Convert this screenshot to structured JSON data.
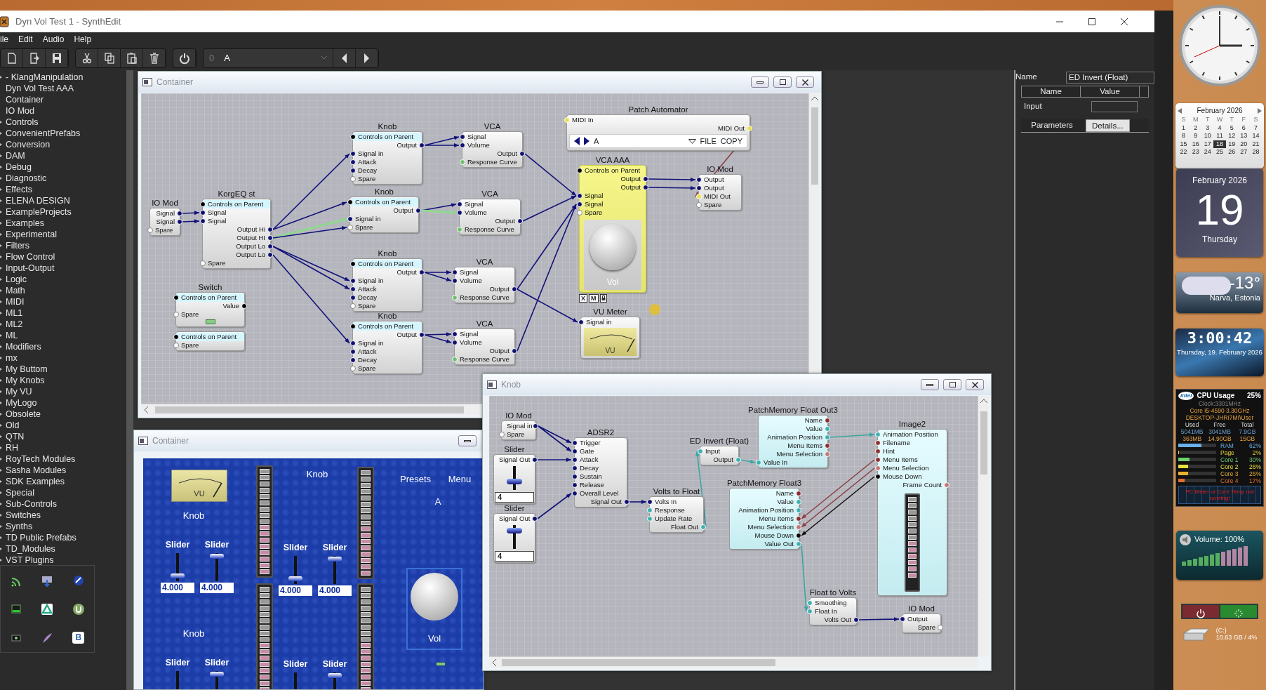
{
  "window": {
    "title": "Dyn Vol Test 1 - SynthEdit"
  },
  "menu": [
    "ile",
    "Edit",
    "Audio",
    "Help"
  ],
  "toolbar": {
    "counter": "0",
    "preset": "A"
  },
  "sidebar": {
    "items": [
      {
        "label": "- KlangManipulation",
        "expandable": true
      },
      {
        "label": "Dyn Vol Test AAA",
        "expandable": false
      },
      {
        "label": "Container",
        "expandable": false
      },
      {
        "label": "IO Mod",
        "expandable": false
      },
      {
        "label": "Controls",
        "expandable": true
      },
      {
        "label": "ConvenientPrefabs",
        "expandable": true
      },
      {
        "label": "Conversion",
        "expandable": true
      },
      {
        "label": "DAM",
        "expandable": true
      },
      {
        "label": "Debug",
        "expandable": true
      },
      {
        "label": "Diagnostic",
        "expandable": true
      },
      {
        "label": "Effects",
        "expandable": true
      },
      {
        "label": "ELENA DESIGN",
        "expandable": true
      },
      {
        "label": "ExampleProjects",
        "expandable": true
      },
      {
        "label": "Examples",
        "expandable": true
      },
      {
        "label": "Experimental",
        "expandable": true
      },
      {
        "label": "Filters",
        "expandable": true
      },
      {
        "label": "Flow Control",
        "expandable": true
      },
      {
        "label": "Input-Output",
        "expandable": true
      },
      {
        "label": "Logic",
        "expandable": true
      },
      {
        "label": "Math",
        "expandable": true
      },
      {
        "label": "MIDI",
        "expandable": true
      },
      {
        "label": "ML1",
        "expandable": true
      },
      {
        "label": "ML2",
        "expandable": true
      },
      {
        "label": "ML",
        "expandable": true
      },
      {
        "label": "Modifiers",
        "expandable": true
      },
      {
        "label": "mx",
        "expandable": true
      },
      {
        "label": "My Buttom",
        "expandable": true
      },
      {
        "label": "My Knobs",
        "expandable": true
      },
      {
        "label": "My VU",
        "expandable": true
      },
      {
        "label": "MyLogo",
        "expandable": true
      },
      {
        "label": "Obsolete",
        "expandable": true
      },
      {
        "label": "Old",
        "expandable": true
      },
      {
        "label": "QTN",
        "expandable": true
      },
      {
        "label": "RH",
        "expandable": true
      },
      {
        "label": "RoyTech Modules",
        "expandable": true
      },
      {
        "label": "Sasha Modules",
        "expandable": true
      },
      {
        "label": "SDK Examples",
        "expandable": true
      },
      {
        "label": "Special",
        "expandable": true
      },
      {
        "label": "Sub-Controls",
        "expandable": true
      },
      {
        "label": "Switches",
        "expandable": true
      },
      {
        "label": "Synths",
        "expandable": true
      },
      {
        "label": "TD Public Prefabs",
        "expandable": true
      },
      {
        "label": "TD_Modules",
        "expandable": true
      },
      {
        "label": "VST Plugins",
        "expandable": true
      }
    ]
  },
  "tray": {
    "badge": "B"
  },
  "windows": [
    {
      "title": "Container",
      "modules": [
        {
          "title": "IO Mod",
          "kind": "plain",
          "selected": false,
          "pins": [
            {
              "label": "Signal",
              "output": true,
              "kind": "audio"
            },
            {
              "label": "Signal",
              "output": true,
              "kind": "audio"
            },
            {
              "label": "Spare",
              "output": false,
              "kind": "spare"
            }
          ]
        },
        {
          "title": "KorgEQ st",
          "kind": "plain",
          "selected": false,
          "pins": [
            {
              "label": "Controls on Parent",
              "output": false,
              "kind": "controls"
            },
            {
              "label": "Signal",
              "output": false,
              "kind": "audio"
            },
            {
              "label": "Signal",
              "output": false,
              "kind": "audio"
            },
            {
              "label": "Output Hi",
              "output": true,
              "kind": "audio"
            },
            {
              "label": "Output HI",
              "output": true,
              "kind": "audio"
            },
            {
              "label": "Output Lo",
              "output": true,
              "kind": "audio"
            },
            {
              "label": "Output Lo",
              "output": true,
              "kind": "audio"
            },
            {
              "label": "Spare",
              "output": false,
              "kind": "spare"
            }
          ]
        },
        {
          "title": "Knob",
          "kind": "plain",
          "selected": false,
          "pins": [
            {
              "label": "Controls on Parent",
              "output": false,
              "kind": "controls"
            },
            {
              "label": "Output",
              "output": true,
              "kind": "audio"
            },
            {
              "label": "Signal in",
              "output": false,
              "kind": "audio"
            },
            {
              "label": "Attack",
              "output": false,
              "kind": "audio"
            },
            {
              "label": "Decay",
              "output": false,
              "kind": "audio"
            },
            {
              "label": "Spare",
              "output": false,
              "kind": "spare"
            }
          ]
        },
        {
          "title": "VCA",
          "kind": "plain",
          "selected": false,
          "pins": [
            {
              "label": "Signal",
              "output": false,
              "kind": "audio"
            },
            {
              "label": "Volume",
              "output": false,
              "kind": "audio"
            },
            {
              "label": "Output",
              "output": true,
              "kind": "audio"
            },
            {
              "label": "Response Curve",
              "output": false,
              "kind": "curve"
            }
          ]
        },
        {
          "title": "Knob",
          "kind": "plain",
          "selected": false,
          "pins": [
            {
              "label": "Controls on Parent",
              "output": false,
              "kind": "controls"
            },
            {
              "label": "Output",
              "output": true,
              "kind": "audio"
            },
            {
              "label": "Signal in",
              "output": false,
              "kind": "audio"
            },
            {
              "label": "Spare",
              "output": false,
              "kind": "spare"
            }
          ]
        },
        {
          "title": "VCA",
          "kind": "plain",
          "selected": false,
          "pins": [
            {
              "label": "Signal",
              "output": false,
              "kind": "audio"
            },
            {
              "label": "Volume",
              "output": false,
              "kind": "audio"
            },
            {
              "label": "Output",
              "output": true,
              "kind": "audio"
            },
            {
              "label": "Response Curve",
              "output": false,
              "kind": "curve"
            }
          ]
        },
        {
          "title": "Knob",
          "kind": "plain",
          "selected": false,
          "pins": [
            {
              "label": "Controls on Parent",
              "output": false,
              "kind": "controls"
            },
            {
              "label": "Output",
              "output": true,
              "kind": "audio"
            },
            {
              "label": "Signal in",
              "output": false,
              "kind": "audio"
            },
            {
              "label": "Attack",
              "output": false,
              "kind": "audio"
            },
            {
              "label": "Decay",
              "output": false,
              "kind": "audio"
            },
            {
              "label": "Spare",
              "output": false,
              "kind": "spare"
            }
          ]
        },
        {
          "title": "VCA",
          "kind": "plain",
          "selected": false,
          "pins": [
            {
              "label": "Signal",
              "output": false,
              "kind": "audio"
            },
            {
              "label": "Volume",
              "output": false,
              "kind": "audio"
            },
            {
              "label": "Output",
              "output": true,
              "kind": "audio"
            },
            {
              "label": "Response Curve",
              "output": false,
              "kind": "curve"
            }
          ]
        },
        {
          "title": "Knob",
          "kind": "plain",
          "selected": false,
          "pins": [
            {
              "label": "Controls on Parent",
              "output": false,
              "kind": "controls"
            },
            {
              "label": "Output",
              "output": true,
              "kind": "audio"
            },
            {
              "label": "Signal in",
              "output": false,
              "kind": "audio"
            },
            {
              "label": "Attack",
              "output": false,
              "kind": "audio"
            },
            {
              "label": "Decay",
              "output": false,
              "kind": "audio"
            },
            {
              "label": "Spare",
              "output": false,
              "kind": "spare"
            }
          ]
        },
        {
          "title": "VCA",
          "kind": "plain",
          "selected": false,
          "pins": [
            {
              "label": "Signal",
              "output": false,
              "kind": "audio"
            },
            {
              "label": "Volume",
              "output": false,
              "kind": "audio"
            },
            {
              "label": "Output",
              "output": true,
              "kind": "audio"
            },
            {
              "label": "Response Curve",
              "output": false,
              "kind": "curve"
            }
          ]
        },
        {
          "title": "Switch",
          "kind": "switch",
          "selected": false,
          "pins": [
            {
              "label": "Controls on Parent",
              "output": false,
              "kind": "controls"
            },
            {
              "label": "Value",
              "output": true,
              "kind": "bool"
            },
            {
              "label": "Spare",
              "output": false,
              "kind": "spare"
            }
          ]
        },
        {
          "kind": "plain",
          "selected": false,
          "pins": [
            {
              "label": "Controls on Parent",
              "output": false,
              "kind": "controls"
            },
            {
              "label": "Spare",
              "output": false,
              "kind": "spare"
            }
          ]
        },
        {
          "title": "Patch Automator",
          "kind": "automator",
          "selected": false,
          "preset": "A",
          "buttons": [
            "FILE",
            "COPY"
          ],
          "pins": [
            {
              "label": "MIDI In",
              "output": false,
              "kind": "midi"
            },
            {
              "label": "MIDI Out",
              "output": true,
              "kind": "midi"
            }
          ]
        },
        {
          "title": "VCA AAA",
          "kind": "knob",
          "selected": true,
          "knob_label": "Vol",
          "tags": [
            "X",
            "M"
          ],
          "pins": [
            {
              "label": "Controls on Parent",
              "output": false,
              "kind": "controls"
            },
            {
              "label": "Output",
              "output": true,
              "kind": "audio"
            },
            {
              "label": "Output",
              "output": true,
              "kind": "audio"
            },
            {
              "label": "Signal",
              "output": false,
              "kind": "audio"
            },
            {
              "label": "Signal",
              "output": false,
              "kind": "audio"
            },
            {
              "label": "Spare",
              "output": false,
              "kind": "spare"
            }
          ]
        },
        {
          "title": "IO Mod",
          "kind": "plain",
          "selected": false,
          "pins": [
            {
              "label": "Output",
              "output": false,
              "kind": "audio"
            },
            {
              "label": "Output",
              "output": false,
              "kind": "audio"
            },
            {
              "label": "MIDI Out",
              "output": false,
              "kind": "midi"
            },
            {
              "label": "Spare",
              "output": false,
              "kind": "spare"
            }
          ]
        },
        {
          "title": "VU Meter",
          "kind": "vu",
          "selected": false,
          "vu_label": "VU",
          "pins": [
            {
              "label": "Signal in",
              "output": false,
              "kind": "audio"
            }
          ]
        }
      ]
    },
    {
      "title": "Knob",
      "modules": [
        {
          "title": "IO Mod",
          "kind": "plain",
          "selected": false,
          "pins": [
            {
              "label": "Signal in",
              "output": true,
              "kind": "audio"
            },
            {
              "label": "Spare",
              "output": false,
              "kind": "spare"
            }
          ]
        },
        {
          "title": "Slider",
          "kind": "slider",
          "selected": false,
          "value": "4",
          "level": 0.3,
          "pins": [
            {
              "label": "Signal Out",
              "output": true,
              "kind": "audio"
            }
          ]
        },
        {
          "title": "Slider",
          "kind": "slider",
          "selected": false,
          "value": "4",
          "level": 0.85,
          "pins": [
            {
              "label": "Signal Out",
              "output": true,
              "kind": "audio"
            }
          ]
        },
        {
          "title": "ADSR2",
          "kind": "plain",
          "selected": false,
          "pins": [
            {
              "label": "Trigger",
              "output": false,
              "kind": "audio"
            },
            {
              "label": "Gate",
              "output": false,
              "kind": "audio"
            },
            {
              "label": "Attack",
              "output": false,
              "kind": "audio"
            },
            {
              "label": "Decay",
              "output": false,
              "kind": "audio"
            },
            {
              "label": "Sustain",
              "output": false,
              "kind": "audio"
            },
            {
              "label": "Release",
              "output": false,
              "kind": "audio"
            },
            {
              "label": "Overall Level",
              "output": false,
              "kind": "audio"
            },
            {
              "label": "Signal Out",
              "output": true,
              "kind": "audio"
            }
          ]
        },
        {
          "title": "Volts to Float",
          "kind": "plain",
          "selected": false,
          "pins": [
            {
              "label": "Volts In",
              "output": false,
              "kind": "audio"
            },
            {
              "label": "Response",
              "output": false,
              "kind": "float"
            },
            {
              "label": "Update Rate",
              "output": false,
              "kind": "float"
            },
            {
              "label": "Float Out",
              "output": true,
              "kind": "float"
            }
          ]
        },
        {
          "title": "ED Invert (Float)",
          "kind": "plain",
          "selected": false,
          "pins": [
            {
              "label": "Input",
              "output": false,
              "kind": "float"
            },
            {
              "label": "Output",
              "output": true,
              "kind": "float"
            }
          ]
        },
        {
          "title": "PatchMemory Float Out3",
          "kind": "gui",
          "selected": false,
          "pins": [
            {
              "label": "Name",
              "output": true,
              "kind": "text"
            },
            {
              "label": "Value",
              "output": true,
              "kind": "float"
            },
            {
              "label": "Animation Position",
              "output": true,
              "kind": "float"
            },
            {
              "label": "Menu Items",
              "output": true,
              "kind": "text"
            },
            {
              "label": "Menu Selection",
              "output": true,
              "kind": "int"
            },
            {
              "label": "Value In",
              "output": false,
              "kind": "float"
            }
          ]
        },
        {
          "title": "PatchMemory Float3",
          "kind": "gui",
          "selected": false,
          "pins": [
            {
              "label": "Name",
              "output": true,
              "kind": "text"
            },
            {
              "label": "Value",
              "output": true,
              "kind": "float"
            },
            {
              "label": "Animation Position",
              "output": true,
              "kind": "float"
            },
            {
              "label": "Menu Items",
              "output": true,
              "kind": "text"
            },
            {
              "label": "Menu Selection",
              "output": true,
              "kind": "int"
            },
            {
              "label": "Mouse Down",
              "output": true,
              "kind": "bool"
            },
            {
              "label": "Value Out",
              "output": true,
              "kind": "float"
            }
          ]
        },
        {
          "title": "Image2",
          "kind": "image",
          "selected": false,
          "pins": [
            {
              "label": "Animation Position",
              "output": false,
              "kind": "float"
            },
            {
              "label": "Filename",
              "output": false,
              "kind": "text"
            },
            {
              "label": "Hint",
              "output": false,
              "kind": "text"
            },
            {
              "label": "Menu Items",
              "output": false,
              "kind": "text"
            },
            {
              "label": "Menu Selection",
              "output": false,
              "kind": "int"
            },
            {
              "label": "Mouse Down",
              "output": false,
              "kind": "bool"
            },
            {
              "label": "Frame Count",
              "output": true,
              "kind": "int"
            }
          ]
        },
        {
          "title": "Float to Volts",
          "kind": "plain",
          "selected": false,
          "pins": [
            {
              "label": "Smoothing",
              "output": false,
              "kind": "float"
            },
            {
              "label": "Float In",
              "output": false,
              "kind": "float"
            },
            {
              "label": "Volts Out",
              "output": true,
              "kind": "audio"
            }
          ]
        },
        {
          "title": "IO Mod",
          "kind": "plain",
          "selected": false,
          "pins": [
            {
              "label": "Output",
              "output": false,
              "kind": "audio"
            },
            {
              "label": "Spare",
              "output": true,
              "kind": "spare"
            }
          ]
        }
      ]
    }
  ],
  "panel_window": {
    "title": "Container",
    "items": [
      {
        "kind": "vu",
        "label": "VU"
      },
      {
        "kind": "caption",
        "text": "Knob"
      },
      {
        "kind": "slider",
        "label": "Slider",
        "value": "4.000",
        "level": 0.12
      },
      {
        "kind": "slider",
        "label": "Slider",
        "value": "4.000",
        "level": 0.95
      },
      {
        "kind": "meter"
      },
      {
        "kind": "meter"
      },
      {
        "kind": "caption",
        "text": "Knob"
      },
      {
        "kind": "slider",
        "label": "Slider",
        "value": "4.000",
        "level": 0.12
      },
      {
        "kind": "slider",
        "label": "Slider",
        "value": "4.000",
        "level": 0.95
      },
      {
        "kind": "meter"
      },
      {
        "kind": "meter"
      },
      {
        "kind": "caption",
        "text": "Presets"
      },
      {
        "kind": "caption",
        "text": "Menu"
      },
      {
        "kind": "caption",
        "text": "A"
      },
      {
        "kind": "knob",
        "label": "Vol"
      },
      {
        "kind": "led"
      },
      {
        "kind": "caption",
        "text": "Knob"
      },
      {
        "kind": "slider",
        "label": "Slider"
      },
      {
        "kind": "slider",
        "label": "Slider",
        "level": 0.95
      },
      {
        "kind": "slider",
        "label": "Slider"
      },
      {
        "kind": "slider",
        "label": "Slider",
        "level": 0.95
      }
    ]
  },
  "properties": {
    "name_label": "Name",
    "name_value": "ED Invert (Float)",
    "columns": [
      "Name",
      "Value"
    ],
    "rows": [
      {
        "name": "Input"
      }
    ],
    "section": "Parameters",
    "details_button": "Details..."
  },
  "gadgets": {
    "calendar": {
      "month": "February 2026",
      "weekdays": [
        "S",
        "M",
        "T",
        "W",
        "T",
        "F",
        "S"
      ],
      "days": [
        {
          "label": "1",
          "selected": false
        },
        {
          "label": "2",
          "selected": false
        },
        {
          "label": "3",
          "selected": false
        },
        {
          "label": "4",
          "selected": false
        },
        {
          "label": "5",
          "selected": false
        },
        {
          "label": "6",
          "selected": false
        },
        {
          "label": "7",
          "selected": false
        },
        {
          "label": "8",
          "selected": false
        },
        {
          "label": "9",
          "selected": false
        },
        {
          "label": "10",
          "selected": false
        },
        {
          "label": "11",
          "selected": false
        },
        {
          "label": "12",
          "selected": false
        },
        {
          "label": "13",
          "selected": false
        },
        {
          "label": "14",
          "selected": false
        },
        {
          "label": "15",
          "selected": false
        },
        {
          "label": "16",
          "selected": false
        },
        {
          "label": "17",
          "selected": false
        },
        {
          "label": "18",
          "selected": true
        },
        {
          "label": "19",
          "selected": false
        },
        {
          "label": "20",
          "selected": false
        },
        {
          "label": "21",
          "selected": false
        },
        {
          "label": "22",
          "selected": false
        },
        {
          "label": "23",
          "selected": false
        },
        {
          "label": "24",
          "selected": false
        },
        {
          "label": "25",
          "selected": false
        },
        {
          "label": "26",
          "selected": false
        },
        {
          "label": "27",
          "selected": false
        },
        {
          "label": "28",
          "selected": false
        }
      ]
    },
    "date_tile": {
      "month": "February 2026",
      "day": "19",
      "weekday": "Thursday"
    },
    "weather": {
      "temperature": "-13°",
      "location": "Narva, Estonia"
    },
    "digital_clock": {
      "time": "3:00:42",
      "date": "Thursday, 19. February 2026"
    },
    "cpu": {
      "logo": "intel",
      "title": "CPU Usage",
      "usage": "25%",
      "clock": "Clock:3301MHz",
      "model": "Core i5-4590 3.30GHz",
      "host": "DESKTOP-JHRI7MI\\User",
      "columns": [
        "Used",
        "Free",
        "Total"
      ],
      "rows": [
        [
          "5041MB",
          "3041MB",
          "7.9GB"
        ],
        [
          "363MB",
          "14.90GB",
          "15GB"
        ]
      ],
      "bars": [
        {
          "label": "RAM",
          "value": "62%",
          "level": 0.62,
          "color": "#6ab0e8"
        },
        {
          "label": "Page",
          "value": "2%",
          "level": 0.02,
          "color": "#e8d040"
        },
        {
          "label": "Core 1",
          "value": "30%",
          "level": 0.3,
          "color": "#70d070"
        },
        {
          "label": "Core 2",
          "value": "26%",
          "level": 0.26,
          "color": "#e8e040"
        },
        {
          "label": "Core 3",
          "value": "26%",
          "level": 0.26,
          "color": "#e8b030"
        },
        {
          "label": "Core 4",
          "value": "17%",
          "level": 0.17,
          "color": "#e07030"
        }
      ],
      "warning": "PC Meter or Core Temp not running!"
    },
    "volume": {
      "label": "Volume: 100%"
    },
    "drive": {
      "name": "(C:)",
      "usage": "10.63 GB / 4%"
    }
  }
}
